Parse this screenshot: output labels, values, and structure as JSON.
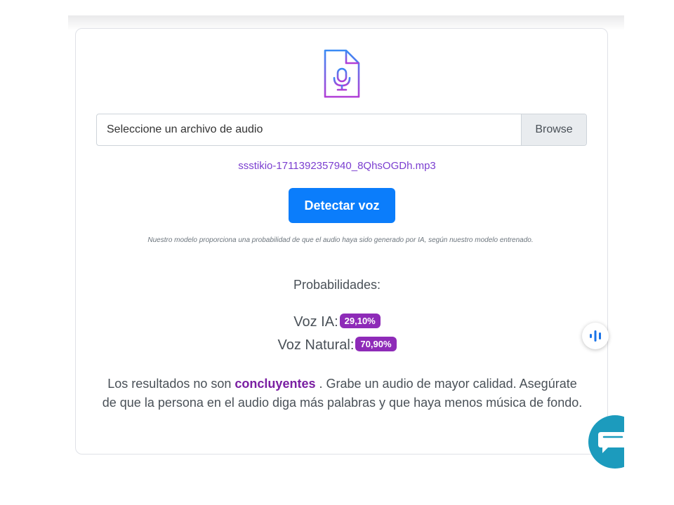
{
  "file_input": {
    "label": "Seleccione un archivo de audio",
    "browse_label": "Browse"
  },
  "selected_file": "ssstikio-1711392357940_8QhsOGDh.mp3",
  "detect_button": "Detectar voz",
  "disclaimer": "Nuestro modelo proporciona una probabilidad de que el audio haya sido generado por IA, según nuestro modelo entrenado.",
  "probabilities": {
    "title": "Probabilidades:",
    "ai_label": "Voz IA:",
    "ai_value": "29,10%",
    "natural_label": "Voz Natural:",
    "natural_value": "70,90%"
  },
  "result": {
    "prefix": "Los resultados no son",
    "emphasis": "concluyentes",
    "suffix": ". Grabe un audio de mayor calidad. Asegúrate de que la persona en el audio diga más palabras y que haya menos música de fondo."
  },
  "colors": {
    "accent_purple": "#8e2bb8",
    "primary_blue": "#0b7dfb",
    "chat_teal": "#1c9bbd"
  },
  "icons": {
    "upload_area": "audio-file-icon",
    "floating_audio": "audio-waveform-icon",
    "chat": "chat-bubble-icon"
  }
}
